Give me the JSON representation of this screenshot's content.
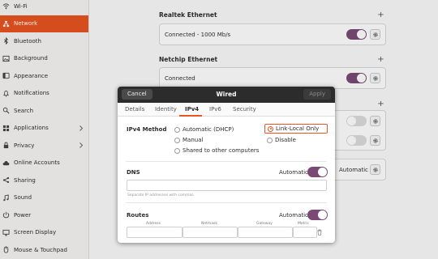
{
  "sidebar": {
    "items": [
      {
        "label": "Wi-Fi",
        "icon": "wifi-icon"
      },
      {
        "label": "Network",
        "icon": "network-icon",
        "active": true
      },
      {
        "label": "Bluetooth",
        "icon": "bluetooth-icon"
      },
      {
        "label": "Background",
        "icon": "background-icon"
      },
      {
        "label": "Appearance",
        "icon": "appearance-icon"
      },
      {
        "label": "Notifications",
        "icon": "bell-icon"
      },
      {
        "label": "Search",
        "icon": "search-icon"
      },
      {
        "label": "Applications",
        "icon": "applications-icon",
        "chevron": true
      },
      {
        "label": "Privacy",
        "icon": "privacy-icon",
        "chevron": true
      },
      {
        "label": "Online Accounts",
        "icon": "cloud-icon"
      },
      {
        "label": "Sharing",
        "icon": "sharing-icon"
      },
      {
        "label": "Sound",
        "icon": "music-note-icon"
      },
      {
        "label": "Power",
        "icon": "power-icon"
      },
      {
        "label": "Screen Display",
        "icon": "display-icon"
      },
      {
        "label": "Mouse & Touchpad",
        "icon": "mouse-icon"
      }
    ]
  },
  "main": {
    "realtek": {
      "title": "Realtek Ethernet",
      "status": "Connected - 1000 Mb/s"
    },
    "netchip": {
      "title": "Netchip Ethernet",
      "status": "Connected"
    },
    "hidden_row_value": "Automatic"
  },
  "dialog": {
    "cancel_label": "Cancel",
    "title": "Wired",
    "apply_label": "Apply",
    "tabs": [
      "Details",
      "Identity",
      "IPv4",
      "IPv6",
      "Security"
    ],
    "active_tab": "IPv4",
    "ipv4_method_label": "IPv4 Method",
    "methods": {
      "automatic_dhcp": "Automatic (DHCP)",
      "link_local_only": "Link-Local Only",
      "manual": "Manual",
      "disable": "Disable",
      "shared": "Shared to other computers"
    },
    "selected_method": "Link-Local Only",
    "dns": {
      "label": "DNS",
      "automatic_label": "Automatic",
      "hint": "Separate IP addresses with commas"
    },
    "routes": {
      "label": "Routes",
      "automatic_label": "Automatic",
      "columns": [
        "Address",
        "Netmask",
        "Gateway",
        "Metric"
      ]
    }
  },
  "colors": {
    "accent": "#e95420",
    "toggle_on": "#7a4a75",
    "header": "#2c2c2c"
  }
}
